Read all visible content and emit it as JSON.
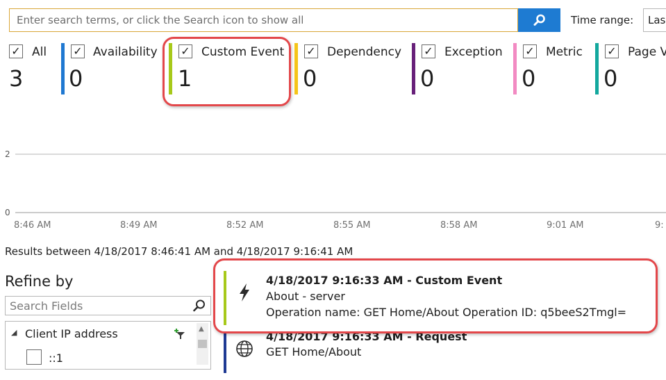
{
  "search": {
    "placeholder": "Enter search terms, or click the Search icon to show all",
    "value": ""
  },
  "time_range": {
    "label": "Time range:",
    "value": "Las"
  },
  "filters": [
    {
      "label": "All",
      "count": "3",
      "checked": "✓",
      "color": ""
    },
    {
      "label": "Availability",
      "count": "0",
      "checked": "✓",
      "color": "#1f78d1"
    },
    {
      "label": "Custom Event",
      "count": "1",
      "checked": "✓",
      "color": "#a7c91a"
    },
    {
      "label": "Dependency",
      "count": "0",
      "checked": "✓",
      "color": "#f5c518"
    },
    {
      "label": "Exception",
      "count": "0",
      "checked": "✓",
      "color": "#68217a"
    },
    {
      "label": "Metric",
      "count": "0",
      "checked": "✓",
      "color": "#f28ac2"
    },
    {
      "label": "Page V",
      "count": "0",
      "checked": "✓",
      "color": "#13a89e"
    }
  ],
  "chart_data": {
    "type": "line",
    "x": [
      "8:46 AM",
      "8:49 AM",
      "8:52 AM",
      "8:55 AM",
      "8:58 AM",
      "9:01 AM",
      "9:"
    ],
    "y_ticks": [
      "2",
      "0"
    ],
    "ylim": [
      0,
      2
    ],
    "grid": true
  },
  "results_summary": "Results between 4/18/2017 8:46:41 AM and 4/18/2017 9:16:41 AM",
  "refine": {
    "title": "Refine by",
    "search_placeholder": "Search Fields",
    "facet_group": "Client IP address",
    "facet_value": "::1"
  },
  "results": [
    {
      "title": "4/18/2017 9:16:33 AM - Custom Event",
      "line1": "About - server",
      "line2": "Operation name: GET Home/About Operation ID: q5beeS2Tmgl=",
      "icon": "lightning-icon",
      "color": "#a7c91a"
    },
    {
      "title": "4/18/2017 9:16:33 AM - Request",
      "line1": "GET Home/About",
      "icon": "globe-icon",
      "color": "#1f3a93"
    }
  ]
}
